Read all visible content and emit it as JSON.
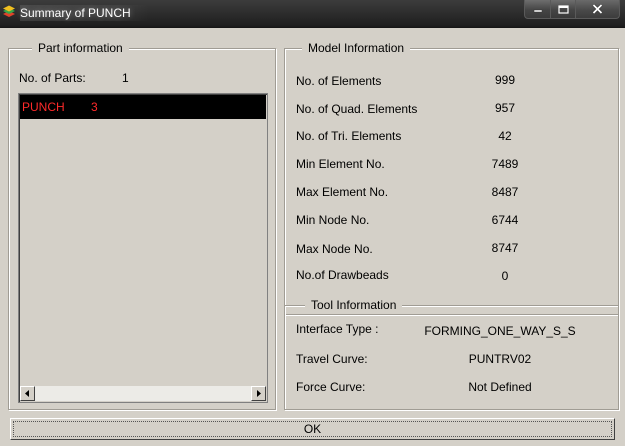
{
  "window": {
    "title": "Summary of PUNCH",
    "icon": "app-icon",
    "controls": [
      "minimize-icon",
      "maximize-icon",
      "close-icon"
    ]
  },
  "part_information": {
    "title": "Part information",
    "no_of_parts_label": "No. of Parts:",
    "no_of_parts_value": "1",
    "parts": [
      {
        "name": "PUNCH",
        "id": "3",
        "selected": true
      }
    ],
    "selected_text_color": "#ff2a2a",
    "selected_bg_color": "#000000"
  },
  "model_information": {
    "title": "Model Information",
    "rows": [
      {
        "label": "No. of Elements",
        "value": "999"
      },
      {
        "label": "No. of Quad. Elements",
        "value": "957"
      },
      {
        "label": "No. of Tri. Elements",
        "value": "42"
      },
      {
        "label": "Min Element No.",
        "value": "7489"
      },
      {
        "label": "Max Element No.",
        "value": "8487"
      },
      {
        "label": "Min Node No.",
        "value": "6744"
      },
      {
        "label": "Max Node No.",
        "value": "8747"
      },
      {
        "label": "No.of Drawbeads",
        "value": "0"
      }
    ]
  },
  "tool_information": {
    "title": "Tool Information",
    "rows": [
      {
        "label": "Interface Type :",
        "value": "FORMING_ONE_WAY_S_S"
      },
      {
        "label": "Travel Curve:",
        "value": "PUNTRV02"
      },
      {
        "label": "Force Curve:",
        "value": "Not Defined"
      }
    ]
  },
  "ok_button": {
    "label": "OK"
  }
}
